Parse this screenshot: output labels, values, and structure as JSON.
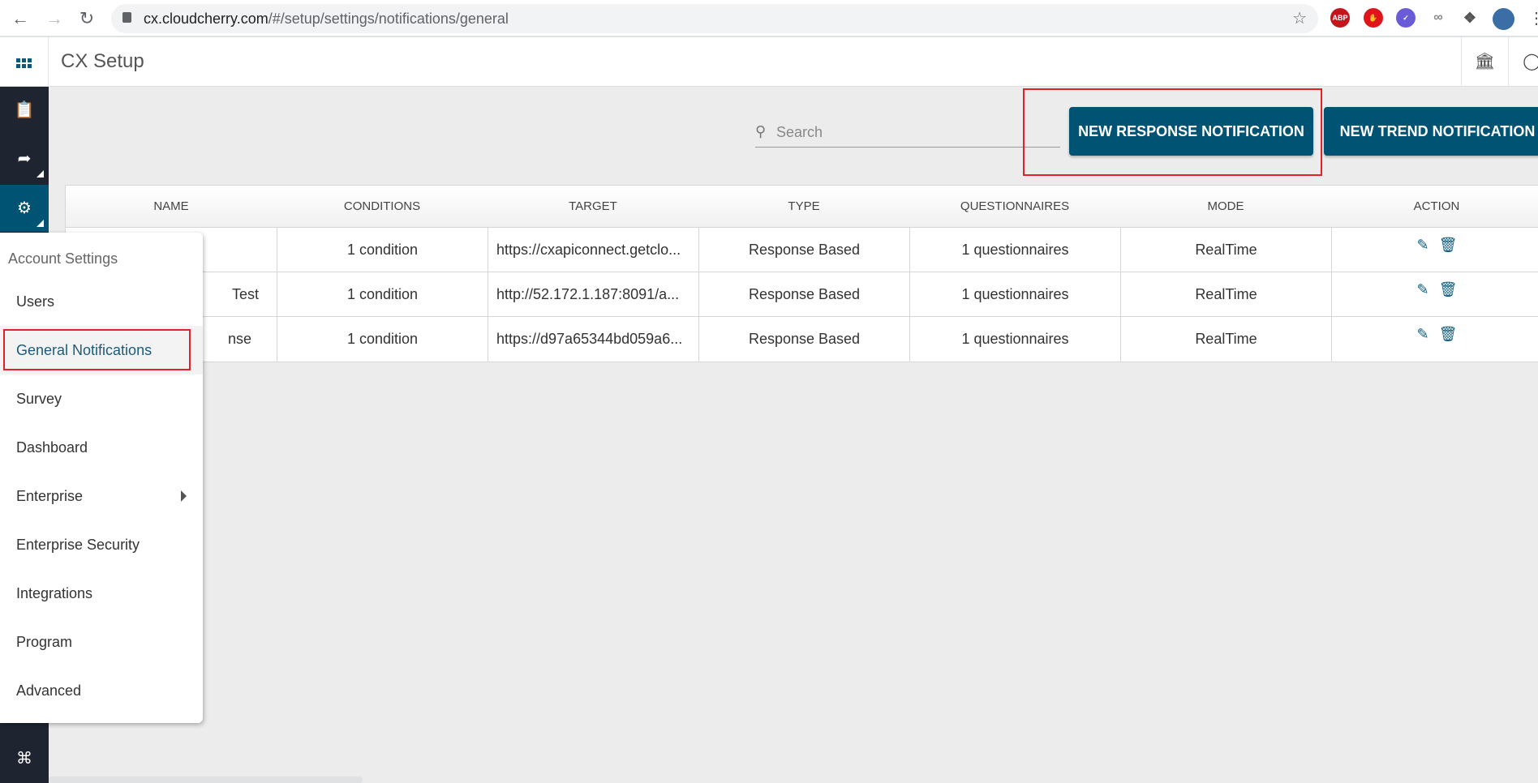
{
  "browser": {
    "url_host": "cx.cloudcherry.com",
    "url_path": "/#/setup/settings/notifications/general",
    "extensions": [
      "adblock-plus-icon",
      "stop-hand-icon",
      "check-badge-icon",
      "link-chain-icon",
      "puzzle-icon",
      "profile-avatar"
    ],
    "ext_abp_label": "ABP"
  },
  "app": {
    "title": "CX Setup"
  },
  "toolbar": {
    "search_placeholder": "Search",
    "search_value": "",
    "new_response_label": "NEW RESPONSE NOTIFICATION",
    "new_trend_label": "NEW TREND NOTIFICATION"
  },
  "table": {
    "columns": [
      "NAME",
      "CONDITIONS",
      "TARGET",
      "TYPE",
      "QUESTIONNAIRES",
      "MODE",
      "ACTION"
    ],
    "rows": [
      {
        "name": "",
        "conditions": "1 condition",
        "target": "https://cxapiconnect.getclo...",
        "type": "Response Based",
        "questionnaires": "1 questionnaires",
        "mode": "RealTime"
      },
      {
        "name": "Test",
        "conditions": "1 condition",
        "target": "http://52.172.1.187:8091/a...",
        "type": "Response Based",
        "questionnaires": "1 questionnaires",
        "mode": "RealTime"
      },
      {
        "name": "nse",
        "conditions": "1 condition",
        "target": "https://d97a65344bd059a6...",
        "type": "Response Based",
        "questionnaires": "1 questionnaires",
        "mode": "RealTime"
      }
    ]
  },
  "menu": {
    "header": "Account Settings",
    "items": [
      "Users",
      "General Notifications",
      "Survey",
      "Dashboard",
      "Enterprise",
      "Enterprise Security",
      "Integrations",
      "Program",
      "Advanced"
    ],
    "active": "General Notifications"
  },
  "colors": {
    "primary": "#005373",
    "sidebar": "#1e2530",
    "highlight": "#e3212a"
  }
}
